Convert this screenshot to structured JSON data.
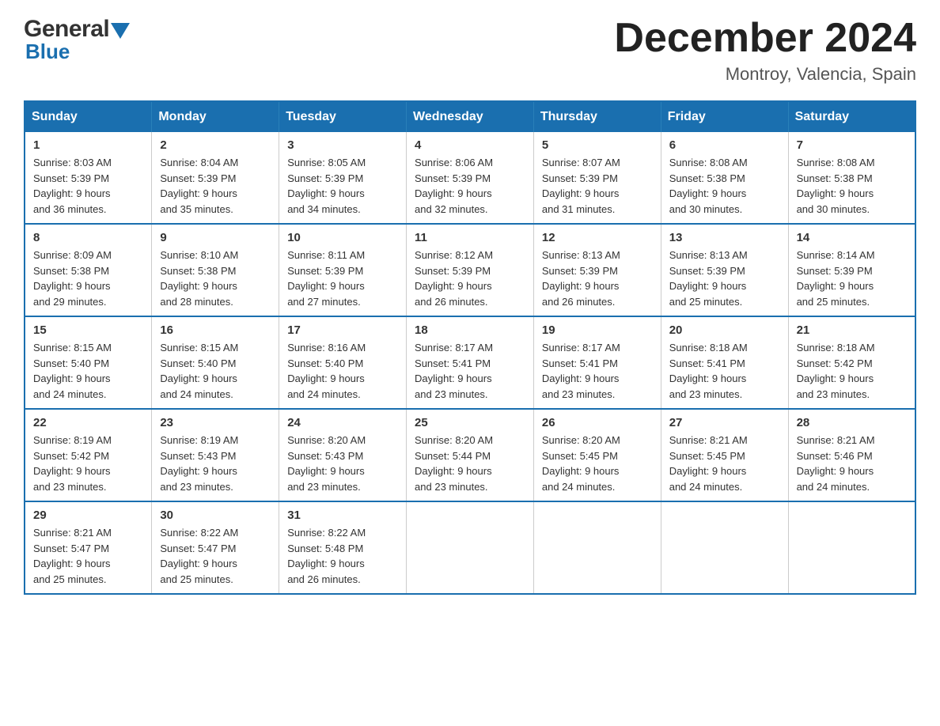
{
  "header": {
    "logo_line1": "General",
    "logo_line2": "Blue",
    "month_title": "December 2024",
    "location": "Montroy, Valencia, Spain"
  },
  "days_of_week": [
    "Sunday",
    "Monday",
    "Tuesday",
    "Wednesday",
    "Thursday",
    "Friday",
    "Saturday"
  ],
  "weeks": [
    [
      {
        "day": "1",
        "sunrise": "8:03 AM",
        "sunset": "5:39 PM",
        "daylight": "9 hours and 36 minutes."
      },
      {
        "day": "2",
        "sunrise": "8:04 AM",
        "sunset": "5:39 PM",
        "daylight": "9 hours and 35 minutes."
      },
      {
        "day": "3",
        "sunrise": "8:05 AM",
        "sunset": "5:39 PM",
        "daylight": "9 hours and 34 minutes."
      },
      {
        "day": "4",
        "sunrise": "8:06 AM",
        "sunset": "5:39 PM",
        "daylight": "9 hours and 32 minutes."
      },
      {
        "day": "5",
        "sunrise": "8:07 AM",
        "sunset": "5:39 PM",
        "daylight": "9 hours and 31 minutes."
      },
      {
        "day": "6",
        "sunrise": "8:08 AM",
        "sunset": "5:38 PM",
        "daylight": "9 hours and 30 minutes."
      },
      {
        "day": "7",
        "sunrise": "8:08 AM",
        "sunset": "5:38 PM",
        "daylight": "9 hours and 30 minutes."
      }
    ],
    [
      {
        "day": "8",
        "sunrise": "8:09 AM",
        "sunset": "5:38 PM",
        "daylight": "9 hours and 29 minutes."
      },
      {
        "day": "9",
        "sunrise": "8:10 AM",
        "sunset": "5:38 PM",
        "daylight": "9 hours and 28 minutes."
      },
      {
        "day": "10",
        "sunrise": "8:11 AM",
        "sunset": "5:39 PM",
        "daylight": "9 hours and 27 minutes."
      },
      {
        "day": "11",
        "sunrise": "8:12 AM",
        "sunset": "5:39 PM",
        "daylight": "9 hours and 26 minutes."
      },
      {
        "day": "12",
        "sunrise": "8:13 AM",
        "sunset": "5:39 PM",
        "daylight": "9 hours and 26 minutes."
      },
      {
        "day": "13",
        "sunrise": "8:13 AM",
        "sunset": "5:39 PM",
        "daylight": "9 hours and 25 minutes."
      },
      {
        "day": "14",
        "sunrise": "8:14 AM",
        "sunset": "5:39 PM",
        "daylight": "9 hours and 25 minutes."
      }
    ],
    [
      {
        "day": "15",
        "sunrise": "8:15 AM",
        "sunset": "5:40 PM",
        "daylight": "9 hours and 24 minutes."
      },
      {
        "day": "16",
        "sunrise": "8:15 AM",
        "sunset": "5:40 PM",
        "daylight": "9 hours and 24 minutes."
      },
      {
        "day": "17",
        "sunrise": "8:16 AM",
        "sunset": "5:40 PM",
        "daylight": "9 hours and 24 minutes."
      },
      {
        "day": "18",
        "sunrise": "8:17 AM",
        "sunset": "5:41 PM",
        "daylight": "9 hours and 23 minutes."
      },
      {
        "day": "19",
        "sunrise": "8:17 AM",
        "sunset": "5:41 PM",
        "daylight": "9 hours and 23 minutes."
      },
      {
        "day": "20",
        "sunrise": "8:18 AM",
        "sunset": "5:41 PM",
        "daylight": "9 hours and 23 minutes."
      },
      {
        "day": "21",
        "sunrise": "8:18 AM",
        "sunset": "5:42 PM",
        "daylight": "9 hours and 23 minutes."
      }
    ],
    [
      {
        "day": "22",
        "sunrise": "8:19 AM",
        "sunset": "5:42 PM",
        "daylight": "9 hours and 23 minutes."
      },
      {
        "day": "23",
        "sunrise": "8:19 AM",
        "sunset": "5:43 PM",
        "daylight": "9 hours and 23 minutes."
      },
      {
        "day": "24",
        "sunrise": "8:20 AM",
        "sunset": "5:43 PM",
        "daylight": "9 hours and 23 minutes."
      },
      {
        "day": "25",
        "sunrise": "8:20 AM",
        "sunset": "5:44 PM",
        "daylight": "9 hours and 23 minutes."
      },
      {
        "day": "26",
        "sunrise": "8:20 AM",
        "sunset": "5:45 PM",
        "daylight": "9 hours and 24 minutes."
      },
      {
        "day": "27",
        "sunrise": "8:21 AM",
        "sunset": "5:45 PM",
        "daylight": "9 hours and 24 minutes."
      },
      {
        "day": "28",
        "sunrise": "8:21 AM",
        "sunset": "5:46 PM",
        "daylight": "9 hours and 24 minutes."
      }
    ],
    [
      {
        "day": "29",
        "sunrise": "8:21 AM",
        "sunset": "5:47 PM",
        "daylight": "9 hours and 25 minutes."
      },
      {
        "day": "30",
        "sunrise": "8:22 AM",
        "sunset": "5:47 PM",
        "daylight": "9 hours and 25 minutes."
      },
      {
        "day": "31",
        "sunrise": "8:22 AM",
        "sunset": "5:48 PM",
        "daylight": "9 hours and 26 minutes."
      },
      null,
      null,
      null,
      null
    ]
  ],
  "labels": {
    "sunrise_prefix": "Sunrise: ",
    "sunset_prefix": "Sunset: ",
    "daylight_prefix": "Daylight: "
  }
}
